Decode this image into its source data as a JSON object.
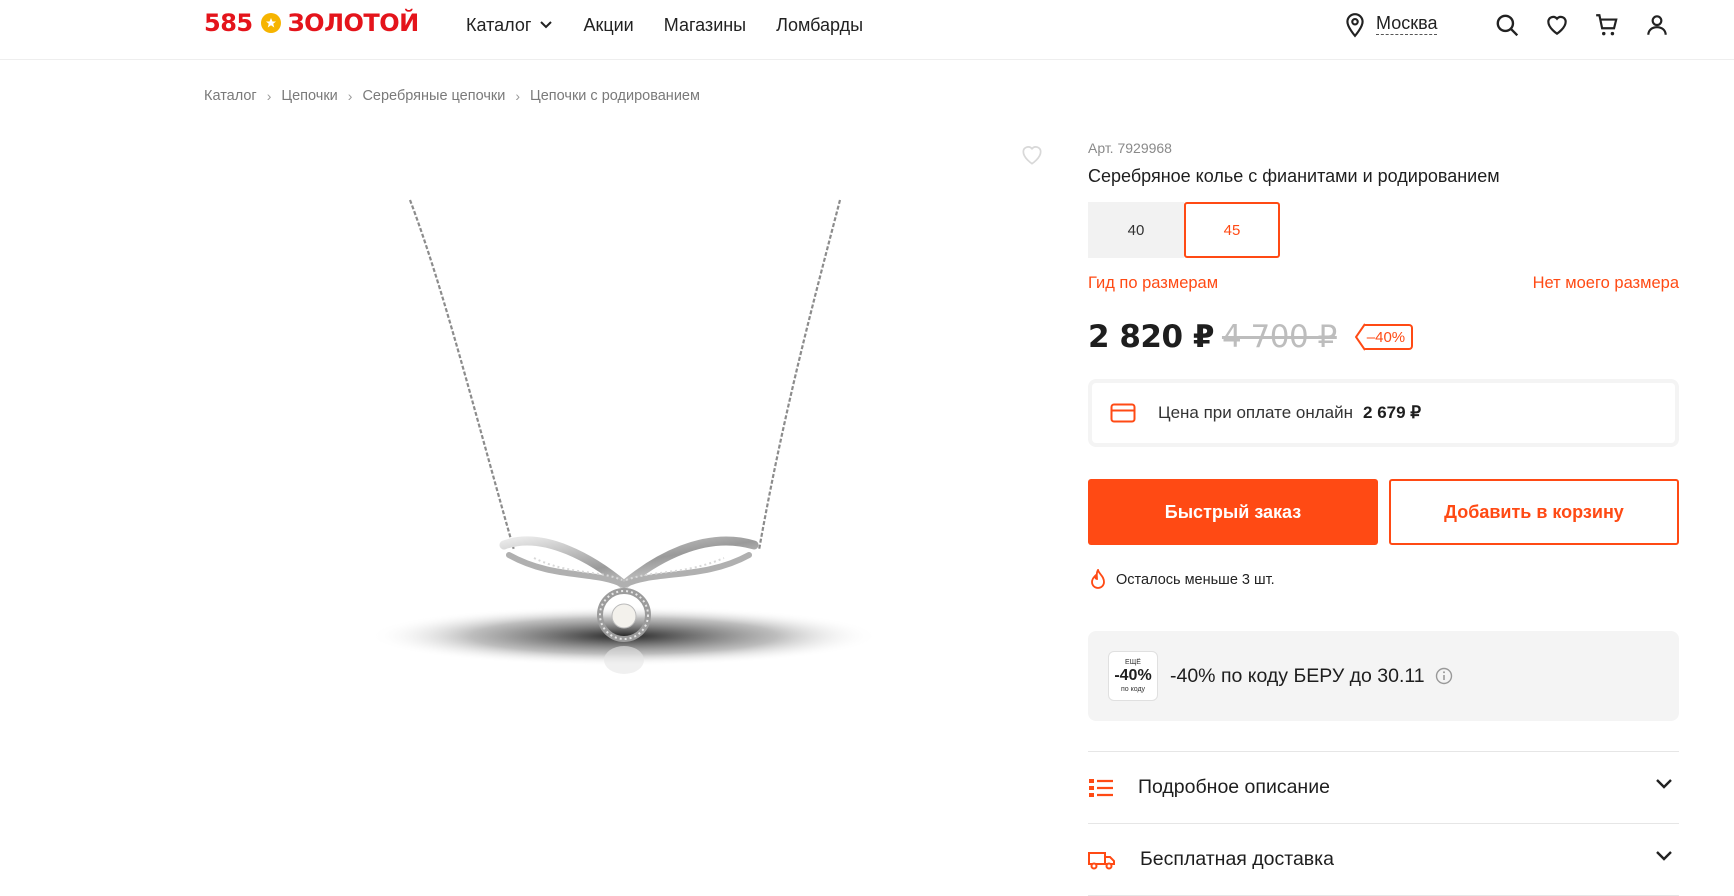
{
  "header": {
    "logo_number": "585",
    "logo_text": "ЗОЛОТОЙ",
    "nav": [
      {
        "label": "Каталог"
      },
      {
        "label": "Акции"
      },
      {
        "label": "Магазины"
      },
      {
        "label": "Ломбарды"
      }
    ],
    "city": "Москва"
  },
  "breadcrumb": [
    "Каталог",
    "Цепочки",
    "Серебряные цепочки",
    "Цепочки с родированием"
  ],
  "product": {
    "article": "Арт. 7929968",
    "title": "Серебряное колье с фианитами и родированием",
    "sizes": [
      {
        "label": "40",
        "selected": false
      },
      {
        "label": "45",
        "selected": true
      }
    ],
    "size_guide": "Гид по размерам",
    "no_size": "Нет моего размера",
    "price": "2 820 ₽",
    "old_price": "4 700 ₽",
    "discount": "–40%",
    "online_label": "Цена при оплате онлайн",
    "online_price": "2 679 ₽",
    "quick_order": "Быстрый заказ",
    "add_to_cart": "Добавить в корзину",
    "stock": "Осталось меньше 3 шт.",
    "promo": {
      "badge_top": "ЕЩЁ",
      "badge_value": "-40%",
      "badge_bottom": "по коду",
      "text": "-40% по коду БЕРУ до 30.11"
    },
    "accordion": [
      {
        "label": "Подробное описание",
        "icon": "list-icon"
      },
      {
        "label": "Бесплатная доставка",
        "icon": "truck-icon"
      }
    ]
  },
  "colors": {
    "accent": "#ff4a14",
    "logo_red": "#e4141b",
    "logo_star": "#f6b400"
  }
}
